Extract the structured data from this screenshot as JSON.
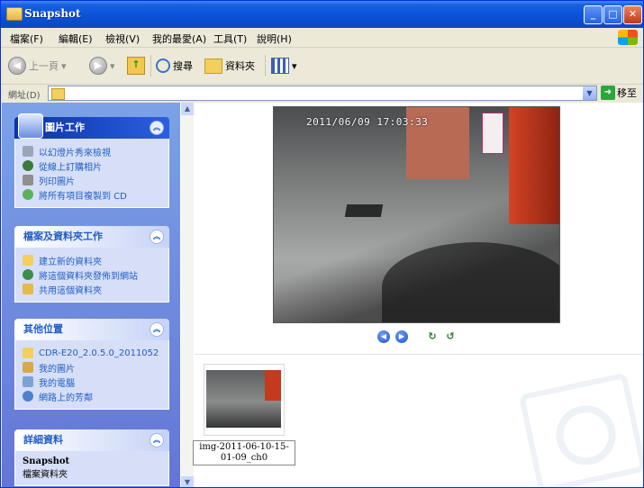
{
  "window": {
    "title": "Snapshot"
  },
  "menu": [
    "檔案(F)",
    "編輯(E)",
    "檢視(V)",
    "我的最愛(A)",
    "工具(T)",
    "說明(H)"
  ],
  "toolbar": {
    "back": "上一頁",
    "search": "搜尋",
    "folders": "資料夾"
  },
  "address": {
    "label": "網址(D)",
    "go": "移至"
  },
  "tasks": {
    "picture": {
      "title": "圖片工作",
      "items": [
        "以幻燈片秀來檢視",
        "從線上訂購相片",
        "列印圖片",
        "將所有項目複製到 CD"
      ]
    },
    "file": {
      "title": "檔案及資料夾工作",
      "items": [
        "建立新的資料夾",
        "將這個資料夾發佈到網站",
        "共用這個資料夾"
      ]
    },
    "other": {
      "title": "其他位置",
      "items": [
        "CDR-E20_2.0.5.0_2011052",
        "我的圖片",
        "我的電腦",
        "網路上的芳鄰"
      ]
    },
    "details": {
      "title": "詳細資料",
      "name": "Snapshot",
      "type": "檔案資料夾"
    }
  },
  "preview": {
    "timestamp": "2011/06/09 17:03:33"
  },
  "file": {
    "caption": "img-2011-06-10-15-01-09_ch0"
  },
  "colors": {
    "titlebar": "#0a52d8",
    "taskpane": "#6f8fe0",
    "taskpane_link": "#215dc6"
  }
}
